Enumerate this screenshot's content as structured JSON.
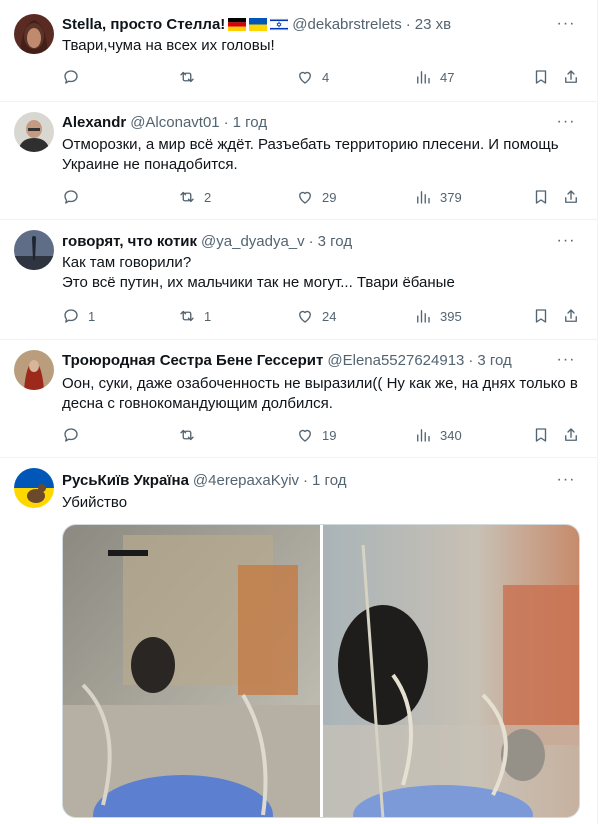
{
  "tweets": [
    {
      "name": "Stella, просто Стелла!",
      "handle": "@dekabrstrelets",
      "time": "23 хв",
      "text": "Твари,чума на всех их головы!",
      "reply": "",
      "retweet": "",
      "like": "4",
      "views": "47"
    },
    {
      "name": "Alexandr",
      "handle": "@Alconavt01",
      "time": "1 год",
      "text": "Отморозки, а мир всё ждёт. Разъебать территорию плесени. И помощь Украине не понадобится.",
      "reply": "",
      "retweet": "2",
      "like": "29",
      "views": "379"
    },
    {
      "name": "говорят, что котик",
      "handle": "@ya_dyadya_v",
      "time": "3 год",
      "text_line1": "Как там говорили?",
      "text_line2": "Это всё путин, их мальчики так не могут... Твари ёбаные",
      "reply": "1",
      "retweet": "1",
      "like": "24",
      "views": "395"
    },
    {
      "name": "Троюродная Сестра Бене Гессерит",
      "handle": "@Elena5527624913",
      "time": "3 год",
      "text": "Оон, суки, даже озабоченность не выразили(( Ну как же, на днях только в десна с говнокомандующим долбился.",
      "reply": "",
      "retweet": "",
      "like": "19",
      "views": "340"
    },
    {
      "name": "РусьКиїв Україна",
      "handle": "@4erepaxaKyiv",
      "time": "1 год",
      "text": "Убийство"
    }
  ],
  "separator": "·",
  "more_glyph": "···",
  "icons": [
    "reply-icon",
    "retweet-icon",
    "like-icon",
    "views-icon",
    "bookmark-icon",
    "share-icon",
    "more-icon"
  ],
  "colors": {
    "text": "#0f1419",
    "secondary": "#536471",
    "border": "#eff3f4"
  }
}
